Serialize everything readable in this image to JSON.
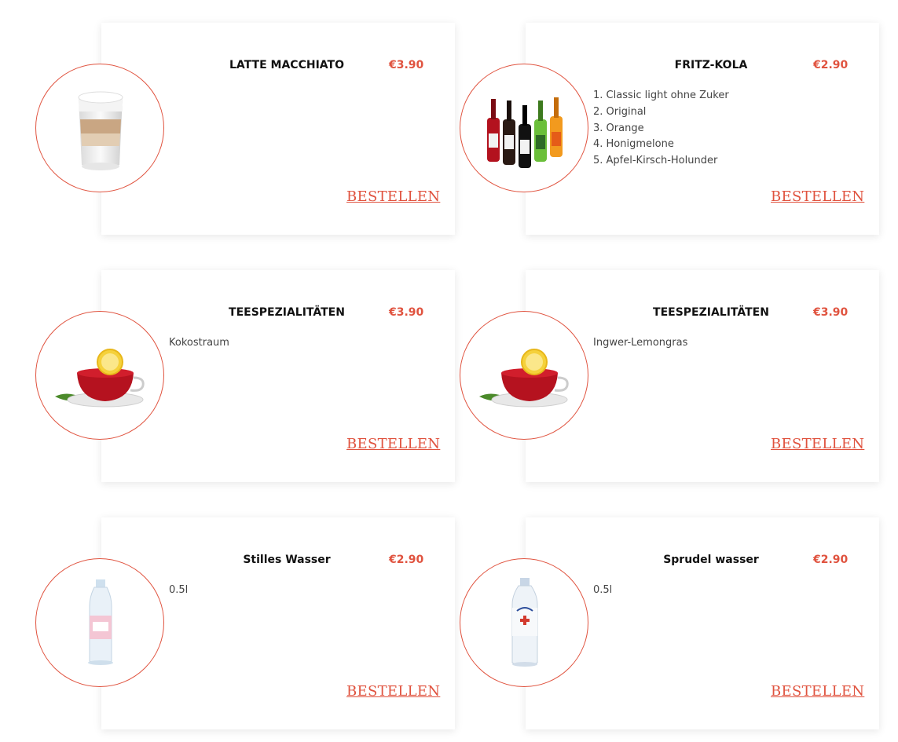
{
  "order_label": "BESTELLEN",
  "colors": {
    "accent": "#e0533f"
  },
  "products": [
    {
      "title": "LATTE MACCHIATO",
      "price": "€3.90",
      "desc": [],
      "icon": "latte-macchiato-image"
    },
    {
      "title": "FRITZ-KOLA",
      "price": "€2.90",
      "desc": [
        "1. Classic light ohne Zuker",
        "2. Original",
        "3. Orange",
        "4. Honigmelone",
        "5. Apfel-Kirsch-Holunder"
      ],
      "icon": "fritz-kola-bottles-image"
    },
    {
      "title": "TEESPEZIALITÄTEN",
      "price": "€3.90",
      "desc": [
        "Kokostraum"
      ],
      "icon": "tea-cup-image"
    },
    {
      "title": "TEESPEZIALITÄTEN",
      "price": "€3.90",
      "desc": [
        "Ingwer-Lemongras"
      ],
      "icon": "tea-cup-image"
    },
    {
      "title": "Stilles Wasser",
      "price": "€2.90",
      "desc": [
        "0.5l"
      ],
      "icon": "still-water-bottle-image"
    },
    {
      "title": "Sprudel wasser",
      "price": "€2.90",
      "desc": [
        "0.5l"
      ],
      "icon": "sparkling-water-bottle-image"
    }
  ]
}
